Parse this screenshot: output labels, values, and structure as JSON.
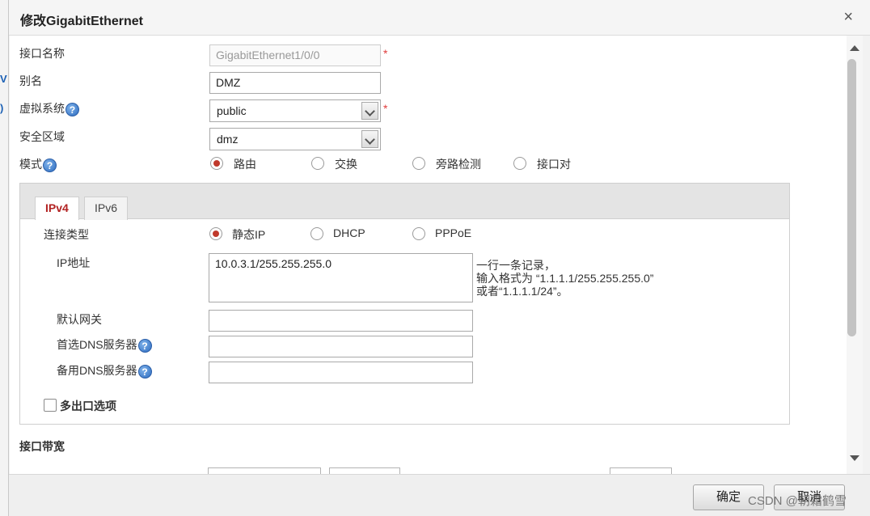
{
  "dialog": {
    "title": "修改GigabitEthernet",
    "close": "×"
  },
  "fields": {
    "if_name_label": "接口名称",
    "if_name_value": "GigabitEthernet1/0/0",
    "alias_label": "别名",
    "alias_value": "DMZ",
    "vsys_label": "虚拟系统",
    "vsys_value": "public",
    "zone_label": "安全区域",
    "zone_value": "dmz",
    "mode_label": "模式",
    "required_mark": "*",
    "help_glyph": "?"
  },
  "mode_options": [
    "路由",
    "交换",
    "旁路检测",
    "接口对"
  ],
  "mode_selected": "路由",
  "tabs": [
    {
      "label": "IPv4",
      "active": true
    },
    {
      "label": "IPv6",
      "active": false
    }
  ],
  "ipv4": {
    "conn_type_label": "连接类型",
    "conn_types": [
      "静态IP",
      "DHCP",
      "PPPoE"
    ],
    "conn_selected": "静态IP",
    "ip_label": "IP地址",
    "ip_value": "10.0.3.1/255.255.255.0",
    "ip_hint_1": "一行一条记录，",
    "ip_hint_2": "输入格式为 “1.1.1.1/255.255.255.0”",
    "ip_hint_3": "或者“1.1.1.1/24”。",
    "gateway_label": "默认网关",
    "gateway_value": "",
    "dns1_label": "首选DNS服务器",
    "dns1_value": "",
    "dns2_label": "备用DNS服务器",
    "dns2_value": "",
    "multi_exit_label": "多出口选项",
    "multi_exit_checked": false
  },
  "bandwidth": {
    "title": "接口带宽"
  },
  "footer": {
    "ok_label": "确定",
    "cancel_label": "取消"
  },
  "watermark": "CSDN @朝霜鹤雪",
  "colors": {
    "radio_selected": "#c0392b",
    "active_tab_text": "#b22222",
    "required": "#e03c3c",
    "help_icon": "#2d6cc0"
  }
}
